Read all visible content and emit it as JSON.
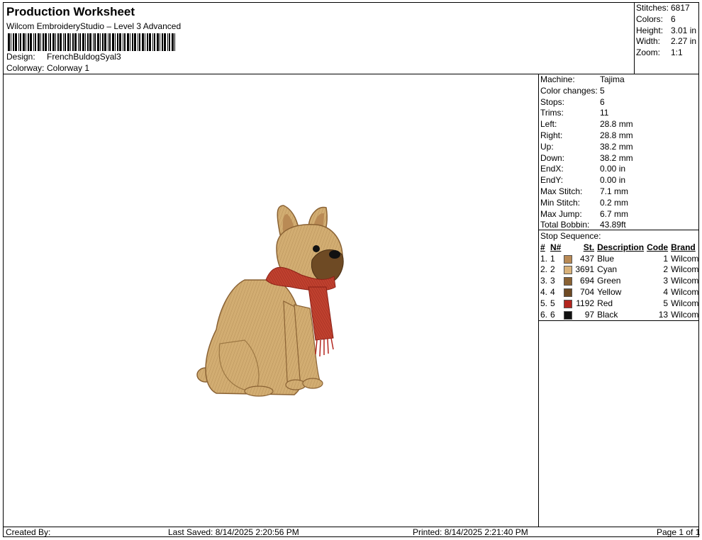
{
  "header": {
    "title": "Production Worksheet",
    "subtitle": "Wilcom EmbroideryStudio – Level 3 Advanced",
    "design_label": "Design:",
    "design_value": "FrenchBuldogSyal3",
    "colorway_label": "Colorway:",
    "colorway_value": "Colorway 1"
  },
  "summary": [
    {
      "label": "Stitches:",
      "value": "6817"
    },
    {
      "label": "Colors:",
      "value": "6"
    },
    {
      "label": "Height:",
      "value": "3.01 in"
    },
    {
      "label": "Width:",
      "value": "2.27 in"
    },
    {
      "label": "Zoom:",
      "value": "1:1"
    }
  ],
  "machine_info": [
    {
      "label": "Machine:",
      "value": "Tajima"
    },
    {
      "label": "Color changes:",
      "value": "5"
    },
    {
      "label": "Stops:",
      "value": "6"
    },
    {
      "label": "Trims:",
      "value": "11"
    },
    {
      "label": "Left:",
      "value": "28.8 mm"
    },
    {
      "label": "Right:",
      "value": "28.8 mm"
    },
    {
      "label": "Up:",
      "value": "38.2 mm"
    },
    {
      "label": "Down:",
      "value": "38.2 mm"
    },
    {
      "label": "EndX:",
      "value": "0.00 in"
    },
    {
      "label": "EndY:",
      "value": "0.00 in"
    },
    {
      "label": "Max Stitch:",
      "value": "7.1 mm"
    },
    {
      "label": "Min Stitch:",
      "value": "0.2 mm"
    },
    {
      "label": "Max Jump:",
      "value": "6.7 mm"
    },
    {
      "label": "Total Bobbin:",
      "value": "43.89ft"
    }
  ],
  "stop_sequence": {
    "title": "Stop Sequence:",
    "headers": {
      "num": "#",
      "n": "N#",
      "st": "St.",
      "desc": "Description",
      "code": "Code",
      "brand": "Brand"
    },
    "rows": [
      {
        "num": "1.",
        "n": "1",
        "color": "#b98a55",
        "st": "437",
        "desc": "Blue",
        "code": "1",
        "brand": "Wilcom"
      },
      {
        "num": "2.",
        "n": "2",
        "color": "#d9b27a",
        "st": "3691",
        "desc": "Cyan",
        "code": "2",
        "brand": "Wilcom"
      },
      {
        "num": "3.",
        "n": "3",
        "color": "#8a6234",
        "st": "694",
        "desc": "Green",
        "code": "3",
        "brand": "Wilcom"
      },
      {
        "num": "4.",
        "n": "4",
        "color": "#6e4a24",
        "st": "704",
        "desc": "Yellow",
        "code": "4",
        "brand": "Wilcom"
      },
      {
        "num": "5.",
        "n": "5",
        "color": "#b3251e",
        "st": "1192",
        "desc": "Red",
        "code": "5",
        "brand": "Wilcom"
      },
      {
        "num": "6.",
        "n": "6",
        "color": "#111111",
        "st": "97",
        "desc": "Black",
        "code": "13",
        "brand": "Wilcom"
      }
    ]
  },
  "footer": {
    "created_by": "Created By:",
    "last_saved": "Last Saved: 8/14/2025 2:20:56 PM",
    "printed": "Printed: 8/14/2025 2:21:40 PM",
    "page": "Page 1 of 1"
  }
}
